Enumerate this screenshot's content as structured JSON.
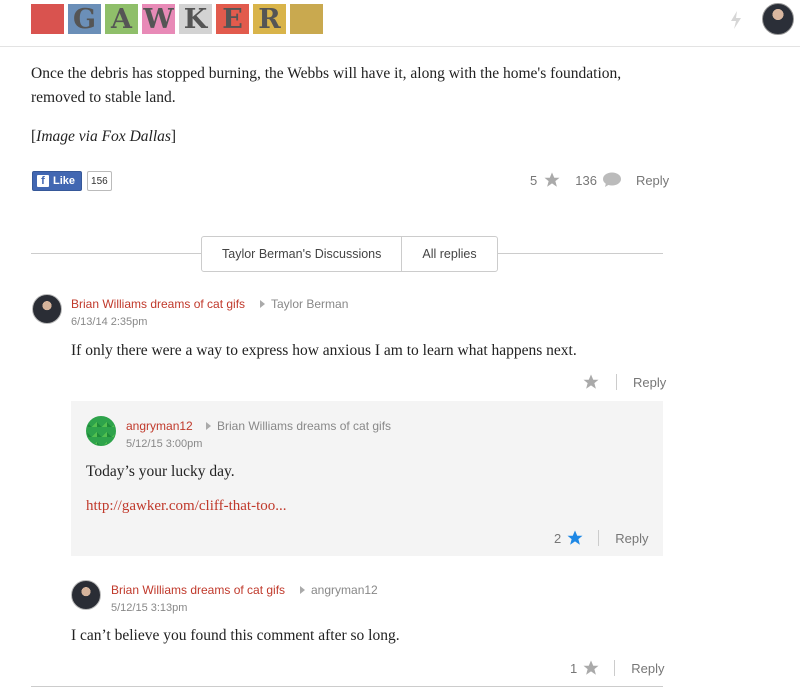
{
  "header": {
    "logo_letters": [
      "G",
      "A",
      "W",
      "K",
      "E",
      "R"
    ],
    "logo_tiles": [
      {
        "letter": "",
        "bg": "#d9534f"
      },
      {
        "letter": "G",
        "bg": "#6b8fb8"
      },
      {
        "letter": "A",
        "bg": "#8fbf6a"
      },
      {
        "letter": "W",
        "bg": "#e88ab7"
      },
      {
        "letter": "K",
        "bg": "#d3d3d3"
      },
      {
        "letter": "E",
        "bg": "#e25b4d"
      },
      {
        "letter": "R",
        "bg": "#d9b44a"
      },
      {
        "letter": "",
        "bg": "#c9a94f"
      }
    ]
  },
  "article": {
    "paragraph": "Once the debris has stopped burning, the Webbs will have it, along with the home's foundation, removed to stable land.",
    "caption_open": "[",
    "caption_italic": "Image via Fox Dallas",
    "caption_close": "]",
    "fb_like_label": "Like",
    "fb_like_count": "156",
    "stars": "5",
    "comments": "136",
    "reply_label": "Reply"
  },
  "discussion_tabs": [
    "Taylor Berman's Discussions",
    "All replies"
  ],
  "comments": [
    {
      "author": "Brian Williams dreams of cat gifs",
      "reply_to": "Taylor Berman",
      "date": "6/13/14 2:35pm",
      "text": "If only there were a way to express how anxious I am to learn what happens next.",
      "stars": "",
      "reply_label": "Reply"
    },
    {
      "author": "angryman12",
      "reply_to": "Brian Williams dreams of cat gifs",
      "date": "5/12/15 3:00pm",
      "text": "Today’s your lucky day.",
      "link": "http://gawker.com/cliff-that-too...",
      "stars": "2",
      "reply_label": "Reply"
    },
    {
      "author": "Brian Williams dreams of cat gifs",
      "reply_to": "angryman12",
      "date": "5/12/15 3:13pm",
      "text": "I can’t believe you found this comment after so long.",
      "stars": "1",
      "reply_label": "Reply"
    }
  ],
  "colors": {
    "accent_red": "#c0392b",
    "star_blue": "#1e88e5",
    "star_grey": "#aaaaaa"
  }
}
